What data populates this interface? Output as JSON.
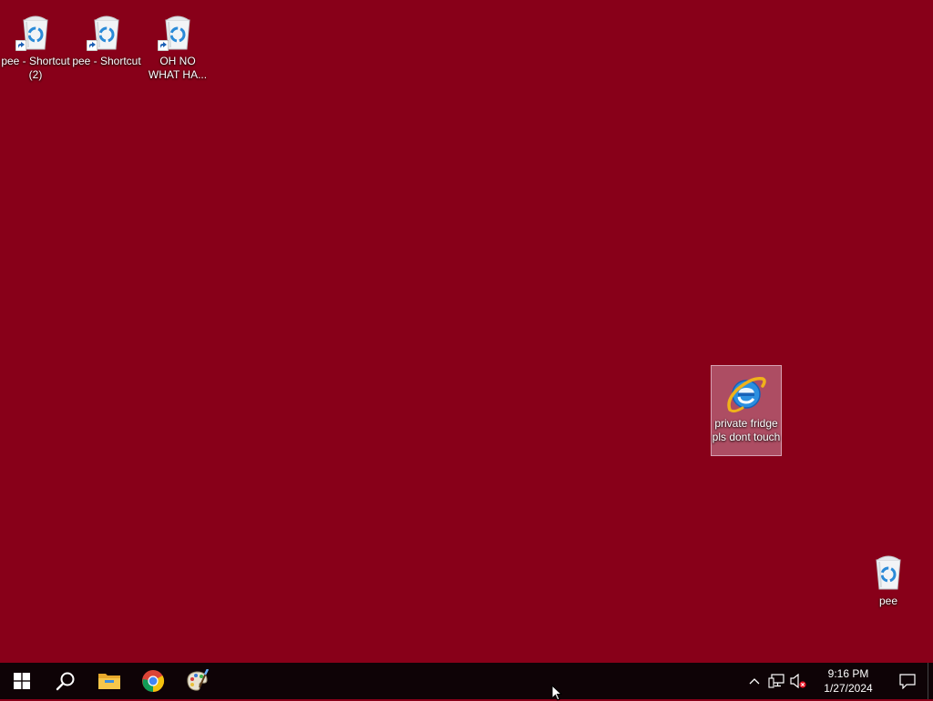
{
  "desktop": {
    "background_color": "#880019",
    "icons": [
      {
        "label": "pee - Shortcut (2)",
        "icon": "recycle-bin-icon",
        "shortcut": true
      },
      {
        "label": "pee - Shortcut",
        "icon": "recycle-bin-icon",
        "shortcut": true
      },
      {
        "label": "OH NO WHAT HA...",
        "icon": "recycle-bin-icon",
        "shortcut": true
      },
      {
        "label": "private fridge pls dont touch",
        "icon": "internet-explorer-icon",
        "selected": true
      },
      {
        "label": "pee",
        "icon": "recycle-bin-icon",
        "shortcut": false
      }
    ]
  },
  "taskbar": {
    "background_color": "#0e0306",
    "pinned": [
      {
        "name": "Start",
        "icon": "windows-logo-icon"
      },
      {
        "name": "Search",
        "icon": "search-icon"
      },
      {
        "name": "File Explorer",
        "icon": "folder-icon"
      },
      {
        "name": "Google Chrome",
        "icon": "chrome-icon"
      },
      {
        "name": "Paint",
        "icon": "paint-palette-icon"
      }
    ],
    "tray": {
      "icons": [
        "chevron-up-icon",
        "network-icon",
        "volume-muted-icon"
      ],
      "time": "9:16 PM",
      "date": "1/27/2024"
    }
  }
}
